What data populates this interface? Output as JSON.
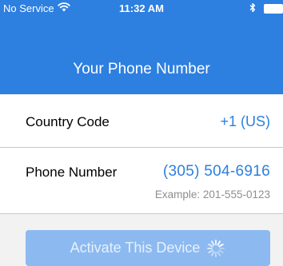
{
  "status_bar": {
    "carrier": "No Service",
    "time": "11:32 AM"
  },
  "nav": {
    "title": "Your Phone Number"
  },
  "country_code": {
    "label": "Country Code",
    "value": "+1 (US)"
  },
  "phone_number": {
    "label": "Phone Number",
    "value": "(305) 504-6916",
    "example": "Example:  201-555-0123"
  },
  "activate_button": {
    "label": "Activate This Device"
  },
  "colors": {
    "accent": "#2d7fe0",
    "button_disabled": "#8cbaf0",
    "secondary_text": "#8e8e93"
  },
  "icons": [
    "wifi-icon",
    "bluetooth-icon",
    "battery-icon",
    "spinner-icon"
  ]
}
